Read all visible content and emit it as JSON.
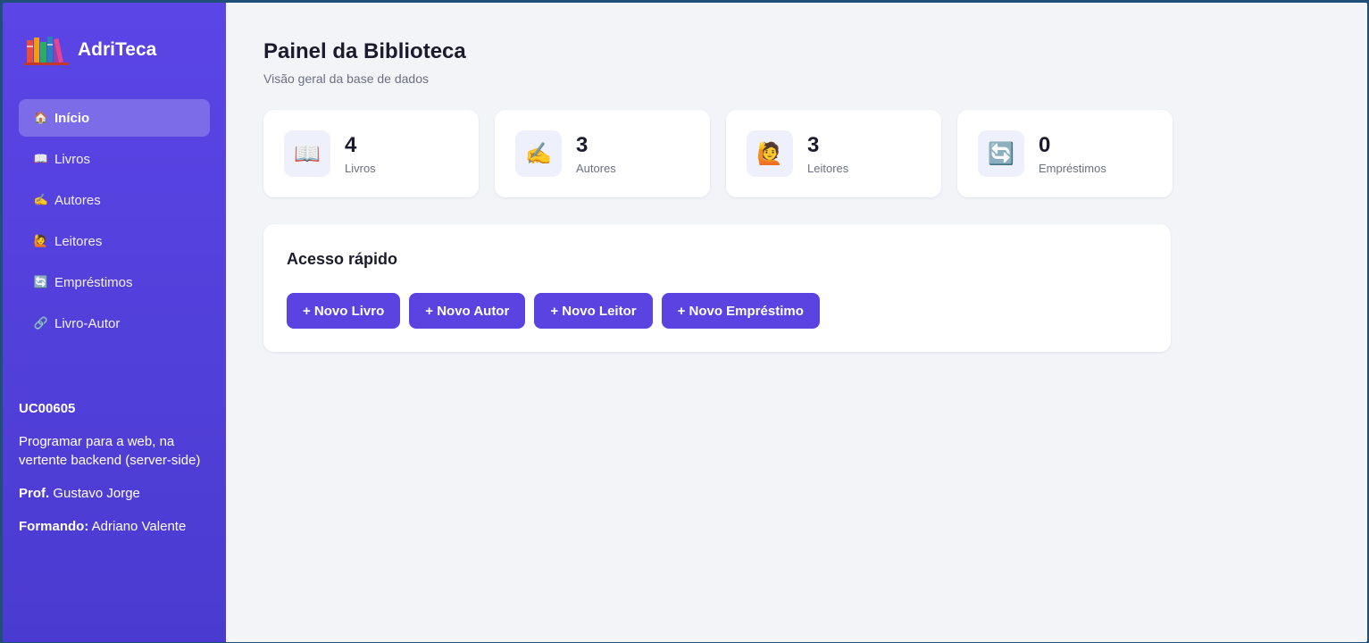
{
  "sidebar": {
    "brand": "AdriTeca",
    "nav": [
      {
        "icon": "🏠",
        "label": "Início",
        "active": true
      },
      {
        "icon": "📖",
        "label": "Livros"
      },
      {
        "icon": "✍️",
        "label": "Autores"
      },
      {
        "icon": "🙋",
        "label": "Leitores"
      },
      {
        "icon": "🔄",
        "label": "Empréstimos"
      },
      {
        "icon": "🔗",
        "label": "Livro-Autor"
      }
    ],
    "info": {
      "code": "UC00605",
      "description": "Programar para a web, na vertente backend (server-side)",
      "prof_label": "Prof.",
      "prof_name": "Gustavo Jorge",
      "student_label": "Formando:",
      "student_name": "Adriano Valente"
    }
  },
  "main": {
    "title": "Painel da Biblioteca",
    "subtitle": "Visão geral da base de dados",
    "stats": [
      {
        "icon": "📖",
        "value": "4",
        "label": "Livros"
      },
      {
        "icon": "✍️",
        "value": "3",
        "label": "Autores"
      },
      {
        "icon": "🙋",
        "value": "3",
        "label": "Leitores"
      },
      {
        "icon": "🔄",
        "value": "0",
        "label": "Empréstimos"
      }
    ],
    "quick": {
      "title": "Acesso rápido",
      "buttons": [
        "+ Novo Livro",
        "+ Novo Autor",
        "+ Novo Leitor",
        "+ Novo Empréstimo"
      ]
    }
  },
  "colors": {
    "accent": "#5a43e0",
    "sidebar": "#5b45e6",
    "background": "#f3f4f8"
  }
}
